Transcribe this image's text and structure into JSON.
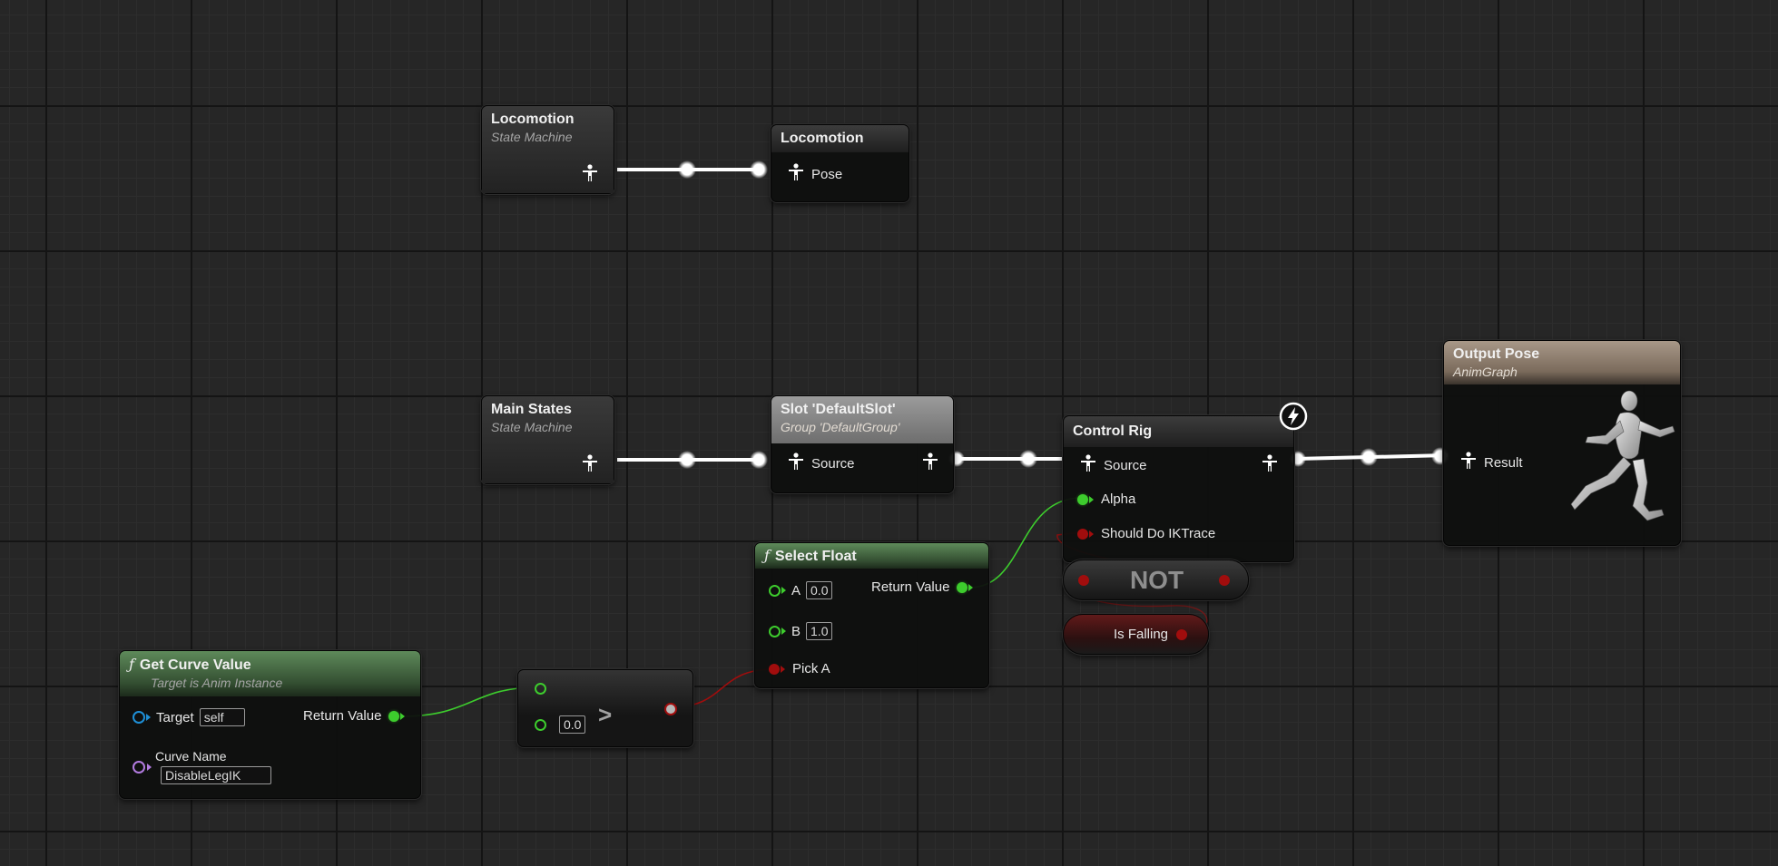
{
  "colors": {
    "pose_wire": "#ffffff",
    "float_wire": "#3dcc2d",
    "bool_wire": "#a10d0d",
    "header_green": "#5e8a5a",
    "header_gray": "#8a8a8a",
    "header_output": "#a89888"
  },
  "nodes": {
    "loco_sm": {
      "title": "Locomotion",
      "subtitle": "State Machine"
    },
    "loco_pose": {
      "title": "Locomotion",
      "pin": "Pose"
    },
    "main_sm": {
      "title": "Main States",
      "subtitle": "State Machine"
    },
    "slot": {
      "title": "Slot 'DefaultSlot'",
      "subtitle": "Group 'DefaultGroup'",
      "in_pin": "Source"
    },
    "control_rig": {
      "title": "Control Rig",
      "source": "Source",
      "alpha": "Alpha",
      "should": "Should Do IKTrace"
    },
    "output_pose": {
      "title": "Output Pose",
      "subtitle": "AnimGraph",
      "result": "Result"
    },
    "select_float": {
      "title": "Select Float",
      "a_label": "A",
      "a_value": "0.0",
      "b_label": "B",
      "b_value": "1.0",
      "pick": "Pick A",
      "ret": "Return Value"
    },
    "not_node": {
      "label": "NOT"
    },
    "is_falling": {
      "label": "Is Falling"
    },
    "get_curve": {
      "title": "Get Curve Value",
      "subtitle": "Target is Anim Instance",
      "target": "Target",
      "target_value": "self",
      "curve": "Curve Name",
      "curve_value": "DisableLegIK",
      "ret": "Return Value"
    },
    "compare": {
      "op": ">",
      "b_value": "0.0"
    }
  },
  "icons": {
    "pose_pin": "mannequin-pose-icon",
    "function": "function-f-icon",
    "lightning": "lightning-bolt-icon",
    "preview": "running-mannequin-icon"
  }
}
